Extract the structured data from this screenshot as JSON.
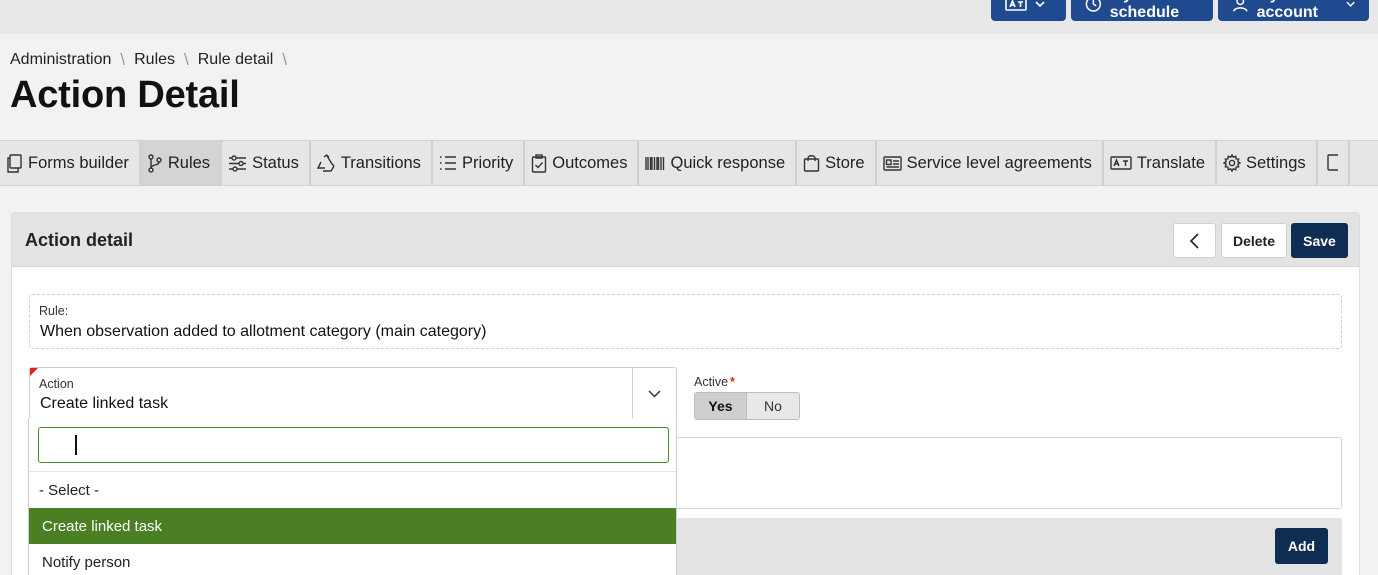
{
  "topbar": {
    "language_button": {
      "icon": "translate-icon",
      "caret": "chevron-down-icon"
    },
    "schedule_label": "My schedule",
    "account_label": "My account",
    "accent_color": "#1f4a8f"
  },
  "breadcrumb": [
    "Administration",
    "Rules",
    "Rule detail"
  ],
  "page_title": "Action Detail",
  "tabs": [
    {
      "label": "Forms builder",
      "icon": "document-copy-icon",
      "active": false
    },
    {
      "label": "Rules",
      "icon": "branch-icon",
      "active": true
    },
    {
      "label": "Status",
      "icon": "sliders-icon",
      "active": false
    },
    {
      "label": "Transitions",
      "icon": "recycle-icon",
      "active": false
    },
    {
      "label": "Priority",
      "icon": "list-icon",
      "active": false
    },
    {
      "label": "Outcomes",
      "icon": "clipboard-check-icon",
      "active": false
    },
    {
      "label": "Quick response",
      "icon": "barcode-icon",
      "active": false
    },
    {
      "label": "Store",
      "icon": "shopping-bag-icon",
      "active": false
    },
    {
      "label": "Service level agreements",
      "icon": "id-card-icon",
      "active": false
    },
    {
      "label": "Translate",
      "icon": "translate-icon",
      "active": false
    },
    {
      "label": "Settings",
      "icon": "gear-icon",
      "active": false
    }
  ],
  "card": {
    "title": "Action detail",
    "delete_label": "Delete",
    "save_label": "Save",
    "add_label": "Add",
    "primary_color": "#0f2d52"
  },
  "rule": {
    "label": "Rule:",
    "value": "When observation added to allotment category (main category)"
  },
  "action": {
    "label": "Action",
    "value": "Create linked task",
    "required": true
  },
  "active": {
    "label": "Active",
    "required_mark": "*",
    "options": [
      "Yes",
      "No"
    ],
    "selected": "Yes"
  },
  "dropdown": {
    "search_value": "",
    "options": [
      "- Select -",
      "Create linked task",
      "Notify person"
    ],
    "selected": "Create linked task",
    "highlight_color": "#4a7f23"
  }
}
